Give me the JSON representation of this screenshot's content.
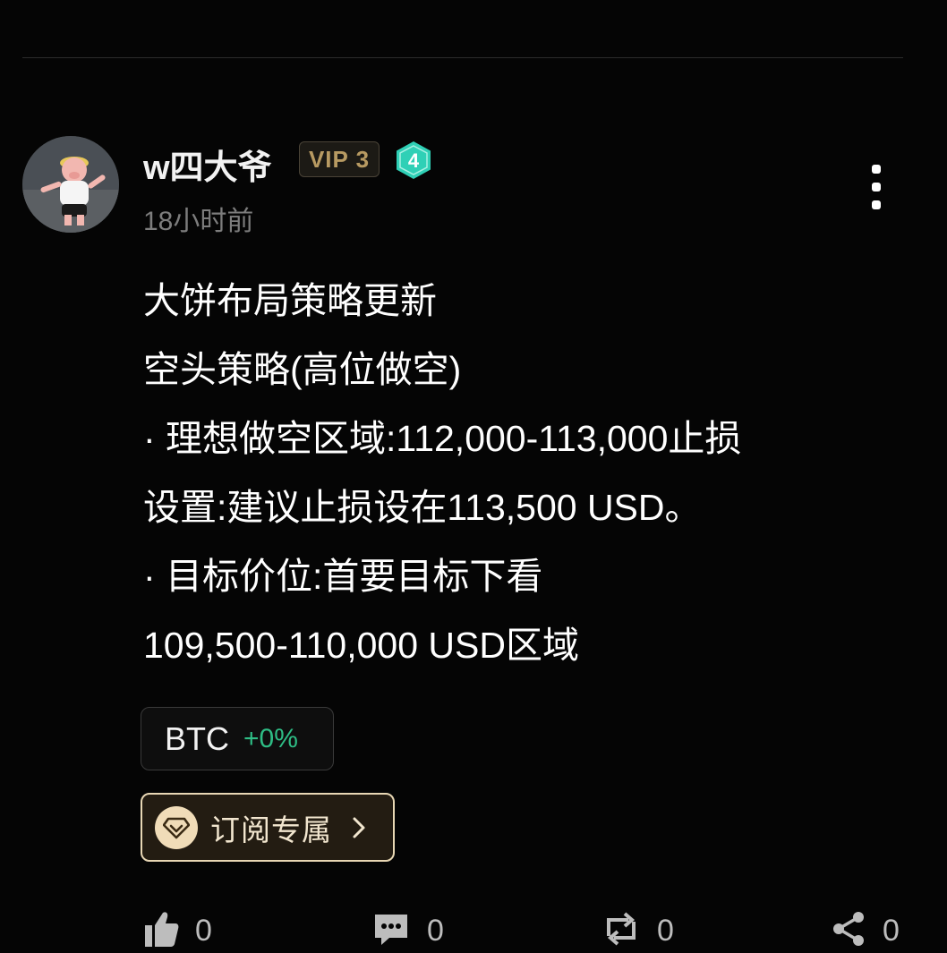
{
  "post": {
    "author": {
      "name": "w四大爷",
      "vip_badge": "VIP 3",
      "level_badge": "4"
    },
    "time_ago": "18小时前",
    "content_lines": [
      "大饼布局策略更新",
      "空头策略(高位做空)",
      "· 理想做空区域:112,000-113,000止损",
      "设置:建议止损设在113,500 USD。",
      "· 目标价位:首要目标下看",
      "109,500-110,000 USD区域"
    ],
    "coin_tag": {
      "symbol": "BTC",
      "change": "+0%"
    },
    "subscribe_button": {
      "label": "订阅专属"
    },
    "actions": {
      "like_count": "0",
      "comment_count": "0",
      "repost_count": "0",
      "share_count": "0"
    }
  },
  "colors": {
    "background": "#050505",
    "positive_green": "#2ebd85",
    "vip_gold": "#b79a62",
    "level_teal": "#2fd0b6",
    "subscribe_border": "#e8d7b4"
  },
  "icons": {
    "more": "vertical-dots-icon",
    "like": "thumbs-up-icon",
    "comment": "comment-icon",
    "repost": "repost-icon",
    "share": "share-icon",
    "subscribe": "diamond-icon",
    "chevron": "chevron-right-icon"
  }
}
